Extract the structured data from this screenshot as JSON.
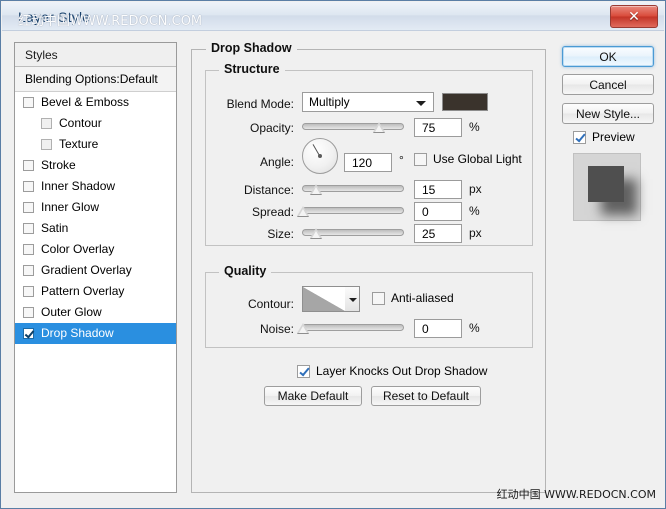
{
  "window": {
    "title": "Layer Style",
    "title_watermark": "红动中国WWW.REDOCN.COM",
    "close_label": "✕",
    "bottom_watermark": "红动中国 WWW.REDOCN.COM",
    "accent_color": "#2a8fe0"
  },
  "sidebar": {
    "header": "Styles",
    "blending_options": "Blending Options:Default",
    "items": [
      {
        "label": "Bevel & Emboss",
        "checked": false,
        "sub": false,
        "selected": false
      },
      {
        "label": "Contour",
        "checked": false,
        "sub": true,
        "selected": false
      },
      {
        "label": "Texture",
        "checked": false,
        "sub": true,
        "selected": false
      },
      {
        "label": "Stroke",
        "checked": false,
        "sub": false,
        "selected": false
      },
      {
        "label": "Inner Shadow",
        "checked": false,
        "sub": false,
        "selected": false
      },
      {
        "label": "Inner Glow",
        "checked": false,
        "sub": false,
        "selected": false
      },
      {
        "label": "Satin",
        "checked": false,
        "sub": false,
        "selected": false
      },
      {
        "label": "Color Overlay",
        "checked": false,
        "sub": false,
        "selected": false
      },
      {
        "label": "Gradient Overlay",
        "checked": false,
        "sub": false,
        "selected": false
      },
      {
        "label": "Pattern Overlay",
        "checked": false,
        "sub": false,
        "selected": false
      },
      {
        "label": "Outer Glow",
        "checked": false,
        "sub": false,
        "selected": false
      },
      {
        "label": "Drop Shadow",
        "checked": true,
        "sub": false,
        "selected": true
      }
    ]
  },
  "main": {
    "panel_title": "Drop Shadow",
    "structure": {
      "title": "Structure",
      "blend_mode_label": "Blend Mode:",
      "blend_mode_value": "Multiply",
      "shadow_color": "#3a332c",
      "opacity_label": "Opacity:",
      "opacity_value": "75",
      "opacity_unit": "%",
      "angle_label": "Angle:",
      "angle_value": "120",
      "angle_unit": "°",
      "use_global_light_label": "Use Global Light",
      "use_global_light_checked": false,
      "distance_label": "Distance:",
      "distance_value": "15",
      "distance_unit": "px",
      "spread_label": "Spread:",
      "spread_value": "0",
      "spread_unit": "%",
      "size_label": "Size:",
      "size_value": "25",
      "size_unit": "px"
    },
    "quality": {
      "title": "Quality",
      "contour_label": "Contour:",
      "anti_aliased_label": "Anti-aliased",
      "anti_aliased_checked": false,
      "noise_label": "Noise:",
      "noise_value": "0",
      "noise_unit": "%"
    },
    "knockout_label": "Layer Knocks Out Drop Shadow",
    "knockout_checked": true,
    "make_default_label": "Make Default",
    "reset_default_label": "Reset to Default"
  },
  "actions": {
    "ok_label": "OK",
    "cancel_label": "Cancel",
    "new_style_label": "New Style...",
    "preview_label": "Preview",
    "preview_checked": true
  }
}
